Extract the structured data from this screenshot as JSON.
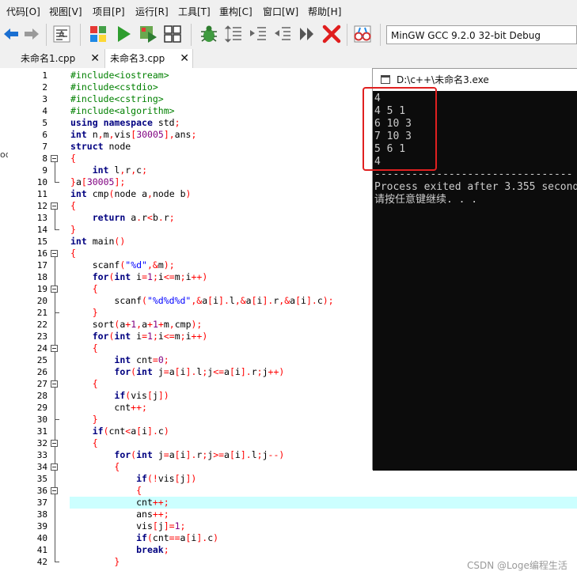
{
  "menu": {
    "items": [
      "代码[O]",
      "视图[V]",
      "项目[P]",
      "运行[R]",
      "工具[T]",
      "重构[C]",
      "窗口[W]",
      "帮助[H]"
    ]
  },
  "toolbar": {
    "compiler": "MinGW GCC 9.2.0 32-bit Debug",
    "icons": [
      "back-arrow-icon",
      "forward-arrow-icon",
      "format-icon",
      "compile-icon",
      "run-icon",
      "compile-run-icon",
      "rebuild-icon",
      "debug-icon",
      "indent-icon",
      "unindent-icon",
      "toggle-comment-icon",
      "goto-icon",
      "stop-icon",
      "profile-icon"
    ]
  },
  "tabs": [
    {
      "label": "未命名1.cpp",
      "active": false
    },
    {
      "label": "未命名3.cpp",
      "active": true
    }
  ],
  "side_panel": {
    "fragment": "od"
  },
  "editor": {
    "highlight_line": 37,
    "lines": [
      {
        "n": 1,
        "t": "#include<iostream>"
      },
      {
        "n": 2,
        "t": "#include<cstdio>"
      },
      {
        "n": 3,
        "t": "#include<cstring>"
      },
      {
        "n": 4,
        "t": "#include<algorithm>"
      },
      {
        "n": 5,
        "t": "using namespace std;"
      },
      {
        "n": 6,
        "t": "int n,m,vis[30005],ans;"
      },
      {
        "n": 7,
        "t": "struct node"
      },
      {
        "n": 8,
        "t": "{"
      },
      {
        "n": 9,
        "t": "    int l,r,c;"
      },
      {
        "n": 10,
        "t": "}a[30005];"
      },
      {
        "n": 11,
        "t": "int cmp(node a,node b)"
      },
      {
        "n": 12,
        "t": "{"
      },
      {
        "n": 13,
        "t": "    return a.r<b.r;"
      },
      {
        "n": 14,
        "t": "}"
      },
      {
        "n": 15,
        "t": "int main()"
      },
      {
        "n": 16,
        "t": "{"
      },
      {
        "n": 17,
        "t": "    scanf(\"%d\",&m);"
      },
      {
        "n": 18,
        "t": "    for(int i=1;i<=m;i++)"
      },
      {
        "n": 19,
        "t": "    {"
      },
      {
        "n": 20,
        "t": "        scanf(\"%d%d%d\",&a[i].l,&a[i].r,&a[i].c);"
      },
      {
        "n": 21,
        "t": "    }"
      },
      {
        "n": 22,
        "t": "    sort(a+1,a+1+m,cmp);"
      },
      {
        "n": 23,
        "t": "    for(int i=1;i<=m;i++)"
      },
      {
        "n": 24,
        "t": "    {"
      },
      {
        "n": 25,
        "t": "        int cnt=0;"
      },
      {
        "n": 26,
        "t": "        for(int j=a[i].l;j<=a[i].r;j++)"
      },
      {
        "n": 27,
        "t": "    {"
      },
      {
        "n": 28,
        "t": "        if(vis[j])"
      },
      {
        "n": 29,
        "t": "        cnt++;"
      },
      {
        "n": 30,
        "t": "    }"
      },
      {
        "n": 31,
        "t": "    if(cnt<a[i].c)"
      },
      {
        "n": 32,
        "t": "    {"
      },
      {
        "n": 33,
        "t": "        for(int j=a[i].r;j>=a[i].l;j--)"
      },
      {
        "n": 34,
        "t": "        {"
      },
      {
        "n": 35,
        "t": "            if(!vis[j])"
      },
      {
        "n": 36,
        "t": "            {"
      },
      {
        "n": 37,
        "t": "            cnt++;"
      },
      {
        "n": 38,
        "t": "            ans++;"
      },
      {
        "n": 39,
        "t": "            vis[j]=1;"
      },
      {
        "n": 40,
        "t": "            if(cnt==a[i].c)"
      },
      {
        "n": 41,
        "t": "            break;"
      },
      {
        "n": 42,
        "t": "        }"
      }
    ]
  },
  "console": {
    "title": "D:\\c++\\未命名3.exe",
    "lines": [
      "4",
      "4 5 1",
      "6 10 3",
      "7 10 3",
      "5 6 1",
      "4",
      "--------------------------------",
      "Process exited after 3.355 seconds",
      "请按任意键继续. . ."
    ]
  },
  "watermark": "CSDN @Loge编程生活",
  "colors": {
    "highlight": "#ccffff",
    "annotation_box": "#e02020",
    "console_bg": "#0c0c0c"
  }
}
